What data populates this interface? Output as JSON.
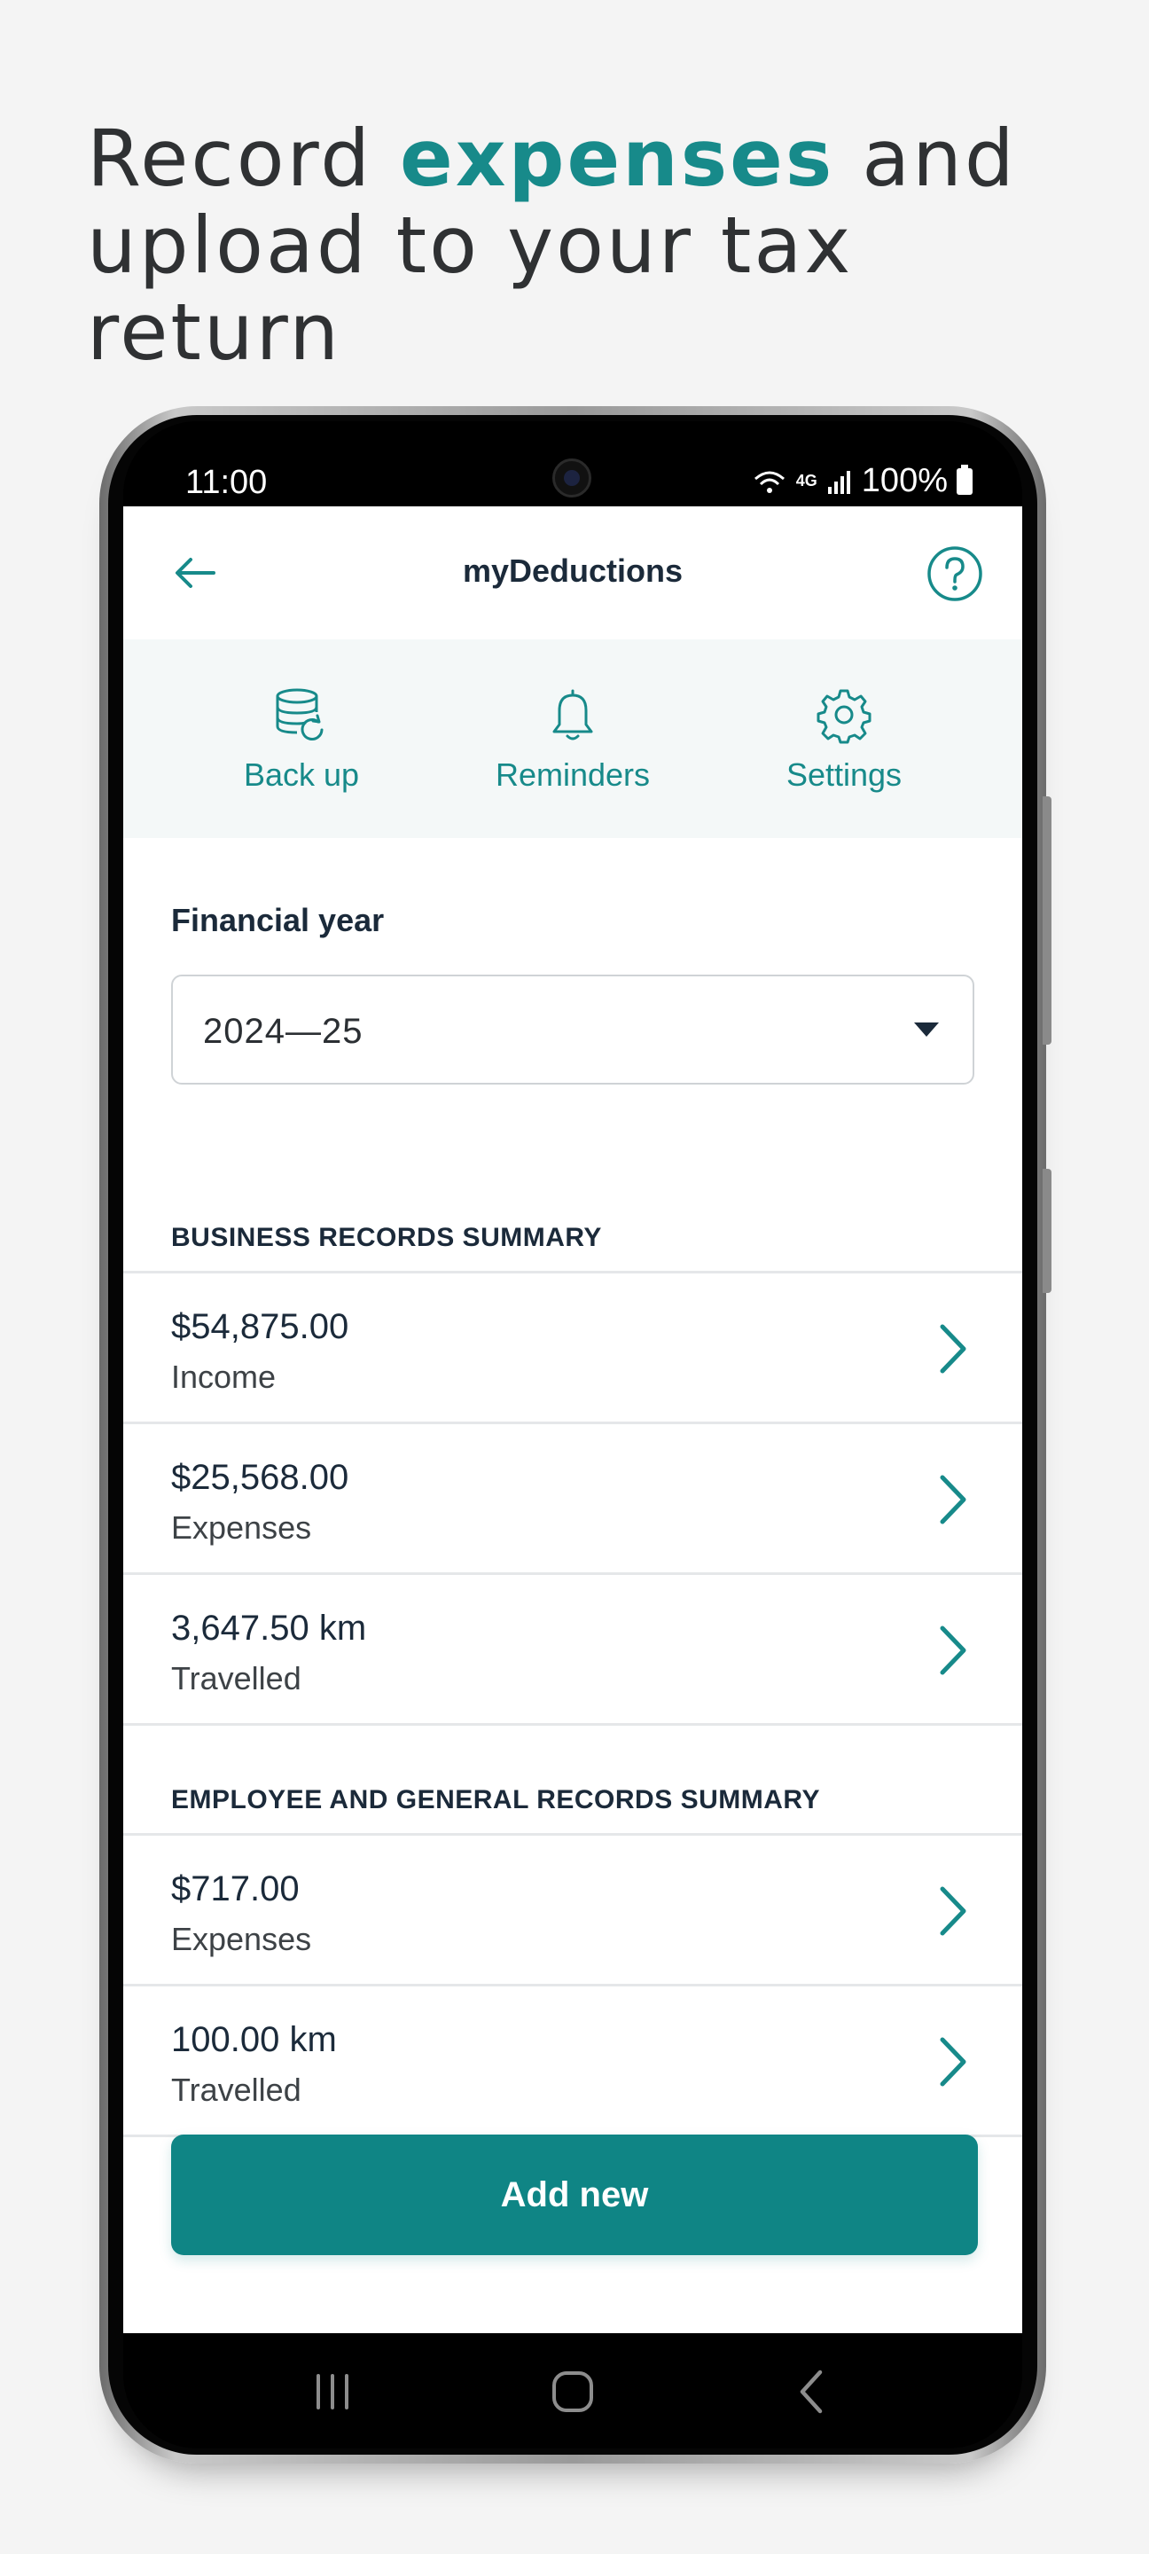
{
  "headline": {
    "line1_prefix": "Record ",
    "line1_accent": "expenses",
    "line1_suffix": " and",
    "line2": "upload to your tax return"
  },
  "status_bar": {
    "time": "11:00",
    "network": "4G",
    "battery": "100%"
  },
  "header": {
    "title": "myDeductions",
    "back_icon": "arrow-left-icon",
    "help_icon": "question-circle-icon"
  },
  "quick_actions": [
    {
      "label": "Back up",
      "icon": "database-backup-icon"
    },
    {
      "label": "Reminders",
      "icon": "bell-icon"
    },
    {
      "label": "Settings",
      "icon": "gear-icon"
    }
  ],
  "financial_year": {
    "label": "Financial year",
    "selected": "2024—25"
  },
  "business_summary": {
    "title": "BUSINESS RECORDS SUMMARY",
    "rows": [
      {
        "value": "$54,875.00",
        "label": "Income"
      },
      {
        "value": "$25,568.00",
        "label": "Expenses"
      },
      {
        "value": "3,647.50 km",
        "label": "Travelled"
      }
    ]
  },
  "employee_summary": {
    "title": "EMPLOYEE AND GENERAL RECORDS SUMMARY",
    "rows": [
      {
        "value": "$717.00",
        "label": "Expenses"
      },
      {
        "value": "100.00 km",
        "label": "Travelled"
      }
    ]
  },
  "add_button": {
    "label": "Add new"
  },
  "colors": {
    "accent": "#178a8a",
    "button": "#0f8585",
    "text_dark": "#1b2a3a"
  }
}
